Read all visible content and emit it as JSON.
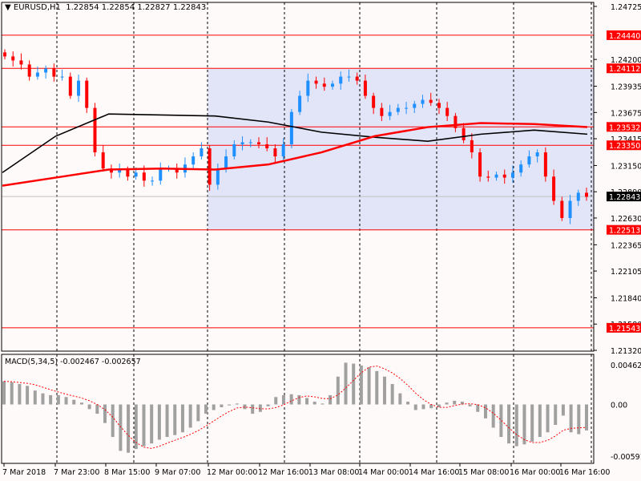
{
  "header": {
    "symbol": "EURUSD,H1",
    "ohlc": "1.22854 1.22854 1.22827 1.22843"
  },
  "macd_title": "MACD(5,34,5) -0.002467 -0.002657",
  "colors": {
    "up": "#1e90ff",
    "down": "#ff0000",
    "bg": "#fffafa",
    "zone": "#e2e5f8",
    "level": "#ff0000",
    "ma_slow": "#ff0000",
    "ma_fast": "#000000"
  },
  "chart_data": [
    {
      "type": "candlestick",
      "title": "EURUSD,H1",
      "ylim": [
        1.2132,
        1.24725
      ],
      "y_ticks": [
        "1.24725",
        "1.24200",
        "1.23935",
        "1.23675",
        "1.23415",
        "1.23150",
        "1.22890",
        "1.22630",
        "1.22365",
        "1.22105",
        "1.21840",
        "1.21580",
        "1.21320"
      ],
      "x_ticks": [
        "7 Mar 2018",
        "7 Mar 23:00",
        "8 Mar 15:00",
        "9 Mar 07:00",
        "12 Mar 00:00",
        "12 Mar 16:00",
        "13 Mar 08:00",
        "14 Mar 00:00",
        "14 Mar 16:00",
        "15 Mar 08:00",
        "16 Mar 00:00",
        "16 Mar 16:00"
      ],
      "closes": [
        1.2423,
        1.2419,
        1.2415,
        1.2403,
        1.2407,
        1.2411,
        1.2403,
        1.2403,
        1.2384,
        1.2399,
        1.2372,
        1.2328,
        1.2312,
        1.2308,
        1.2311,
        1.2304,
        1.2308,
        1.23,
        1.23,
        1.2312,
        1.2312,
        1.2308,
        1.2316,
        1.2324,
        1.2332,
        1.2296,
        1.2312,
        1.2324,
        1.2336,
        1.2338,
        1.2338,
        1.2336,
        1.2332,
        1.2324,
        1.2336,
        1.2368,
        1.2384,
        1.2399,
        1.2396,
        1.2393,
        1.2396,
        1.2403,
        1.2403,
        1.2399,
        1.2384,
        1.2372,
        1.2364,
        1.2368,
        1.2372,
        1.2372,
        1.2376,
        1.238,
        1.2377,
        1.2372,
        1.2364,
        1.2352,
        1.234,
        1.2328,
        1.2304,
        1.2303,
        1.2306,
        1.2303,
        1.2308,
        1.2316,
        1.2324,
        1.2328,
        1.2304,
        1.228,
        1.2263,
        1.228,
        1.2288,
        1.2284
      ],
      "ma_red": [
        1.2295,
        1.2303,
        1.2311,
        1.2312,
        1.2311,
        1.2316,
        1.2328,
        1.2344,
        1.2353,
        1.2357,
        1.2356,
        1.2353
      ],
      "ma_black": [
        1.2308,
        1.2344,
        1.2366,
        1.2365,
        1.2364,
        1.2358,
        1.2348,
        1.2343,
        1.2339,
        1.2346,
        1.235,
        1.2346
      ],
      "levels": [
        "1.24440",
        "1.24112",
        "1.23532",
        "1.23350",
        "1.22513",
        "1.21543"
      ],
      "current_price": "1.22843",
      "zone": {
        "from_label": "12 Mar 00:00",
        "top": 1.24112,
        "bottom": 1.22513
      }
    },
    {
      "type": "bar",
      "title": "MACD(5,34,5)",
      "ylim": [
        -0.005914,
        0.004622
      ],
      "y_ticks": [
        "0.004622",
        "0.00",
        "-0.005914"
      ],
      "histogram": [
        0.0025,
        0.0024,
        0.0022,
        0.002,
        0.0015,
        0.0012,
        0.001,
        0.001,
        0.0008,
        0.0005,
        0.0002,
        -0.0005,
        -0.001,
        -0.002,
        -0.0035,
        -0.005,
        -0.0052,
        -0.0048,
        -0.0045,
        -0.0042,
        -0.0038,
        -0.0035,
        -0.0033,
        -0.003,
        -0.0025,
        -0.0018,
        -0.001,
        -0.0006,
        -0.0003,
        -0.0001,
        0.0001,
        -0.0005,
        -0.001,
        -0.0008,
        -0.0002,
        0.0008,
        0.001,
        0.0011,
        0.001,
        0.0007,
        0.0003,
        0.0001,
        0.001,
        0.003,
        0.0045,
        0.0044,
        0.0042,
        0.004,
        0.0036,
        0.003,
        0.0022,
        0.0012,
        0.0003,
        -0.0006,
        -0.0005,
        -0.0004,
        -0.0003,
        0.0002,
        0.0004,
        0.0003,
        -0.0002,
        -0.0008,
        -0.0015,
        -0.0025,
        -0.0035,
        -0.0042,
        -0.0045,
        -0.0043,
        -0.004,
        -0.0035,
        -0.003,
        -0.0022,
        -0.0012,
        -0.003,
        -0.0032,
        -0.0028
      ]
    }
  ]
}
